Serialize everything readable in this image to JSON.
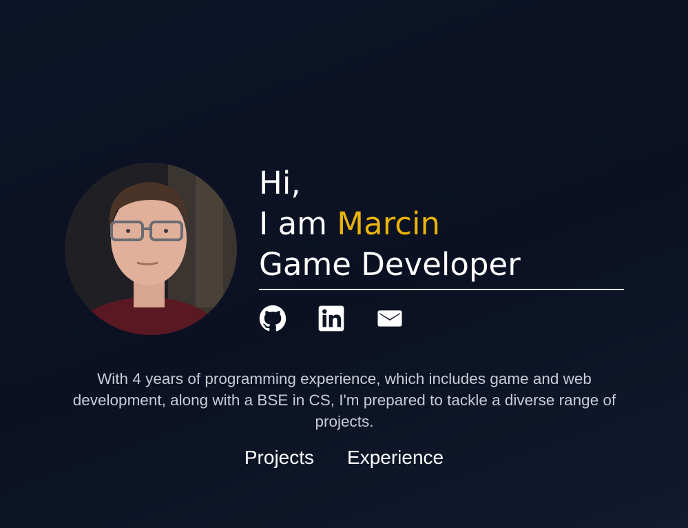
{
  "profile": {
    "photo_alt": "Portrait of Marcin"
  },
  "hero": {
    "greeting": "Hi,",
    "intro_prefix": "I am ",
    "name": "Marcin",
    "role": "Game Developer"
  },
  "socials": [
    {
      "icon": "github-icon",
      "label": "GitHub"
    },
    {
      "icon": "linkedin-icon",
      "label": "LinkedIn"
    },
    {
      "icon": "mail-icon",
      "label": "Email"
    }
  ],
  "bio": "With 4 years of programming experience, which includes game and web development, along with a BSE in CS, I'm prepared to tackle a diverse range of projects.",
  "nav": {
    "projects": "Projects",
    "experience": "Experience"
  },
  "colors": {
    "accent": "#eab308",
    "background": "#0d1427",
    "text": "#ffffff",
    "muted_text": "#c8ccd6"
  }
}
